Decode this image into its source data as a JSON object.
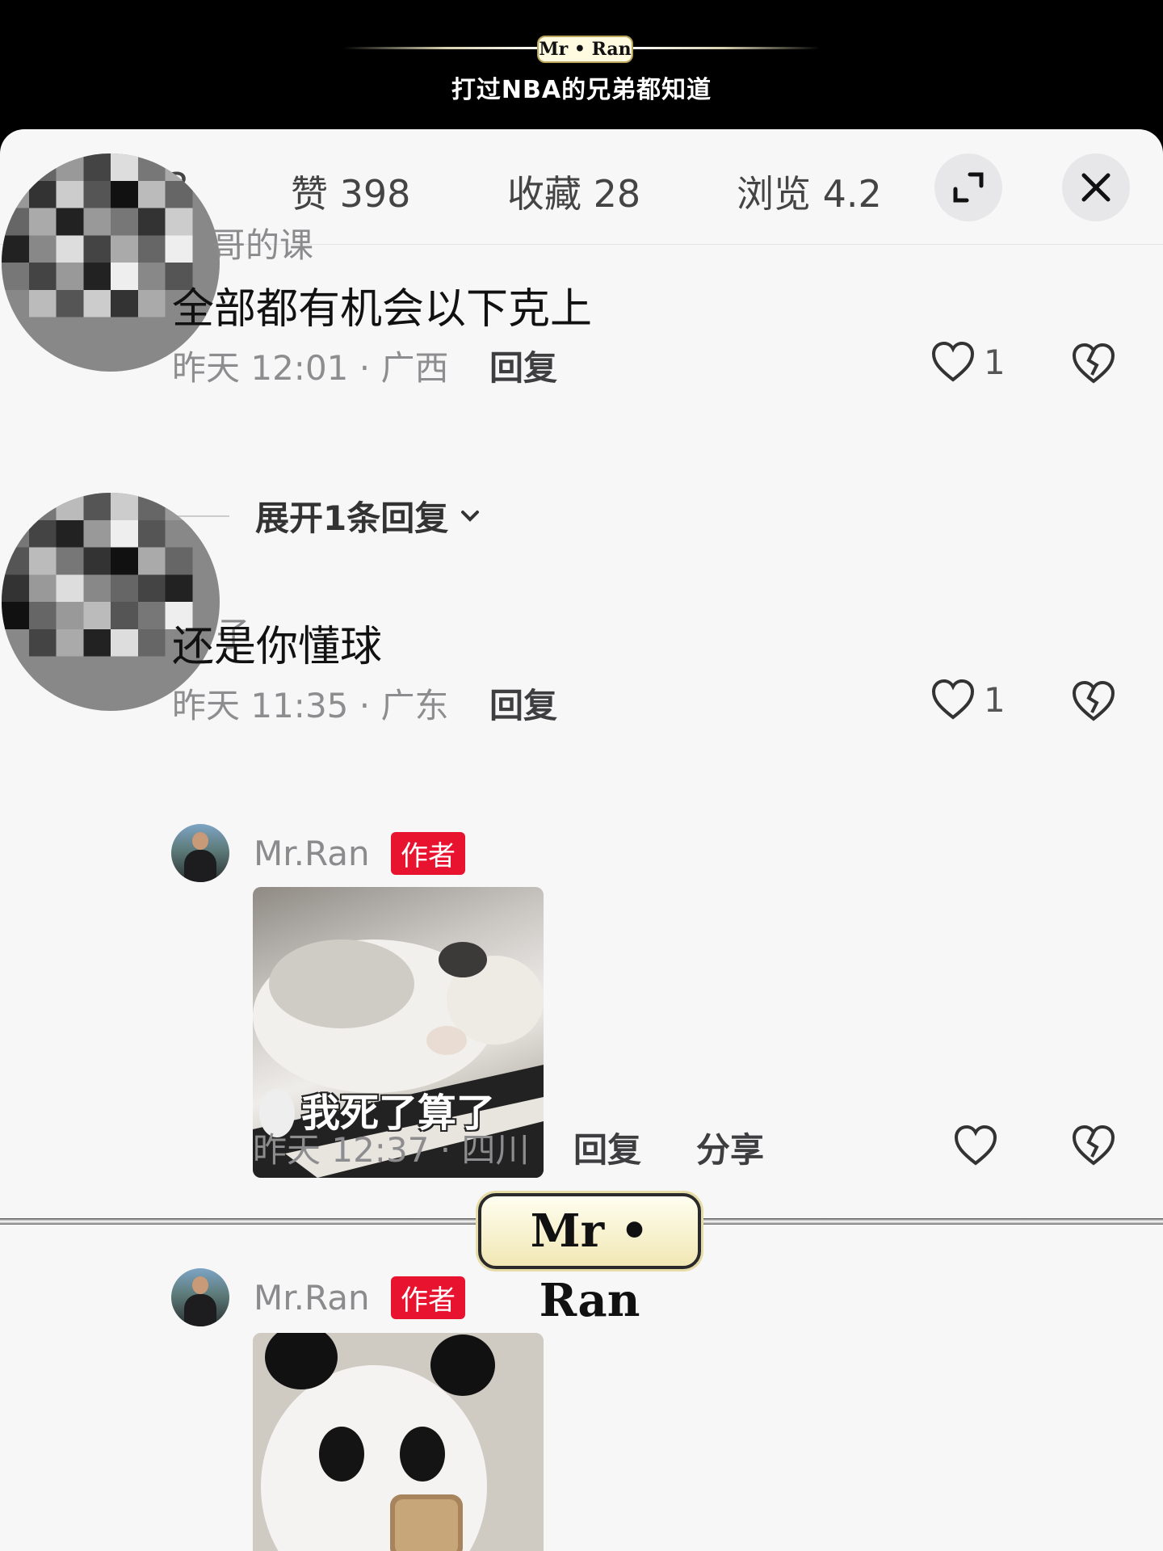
{
  "banner": {
    "logo": "Mr • Ran",
    "subtitle": "打过NBA的兄弟都知道"
  },
  "stats": {
    "comments": "3",
    "likes": "赞 398",
    "favorites": "收藏 28",
    "views": "浏览 4.2"
  },
  "comments": [
    {
      "name": "哥的课",
      "text": "全部都有机会以下克上",
      "time": "昨天 12:01 · 广西",
      "reply": "回复",
      "likes": "1",
      "expand": "展开1条回复"
    },
    {
      "name": "子",
      "text": "还是你懂球",
      "time": "昨天 11:35 · 广东",
      "reply": "回复",
      "likes": "1"
    }
  ],
  "replies": [
    {
      "name": "Mr.Ran",
      "badge": "作者",
      "sticker_caption": "我死了算了",
      "time": "昨天 12:37 · 四川",
      "reply": "回复",
      "share": "分享"
    },
    {
      "name": "Mr.Ran",
      "badge": "作者"
    }
  ],
  "watermark": "Mr • Ran",
  "colors": {
    "badge": "#e8132f",
    "sheet": "#f7f7f8"
  },
  "icons": [
    "expand-icon",
    "close-icon",
    "heart-icon",
    "broken-heart-icon",
    "chevron-down-icon"
  ]
}
